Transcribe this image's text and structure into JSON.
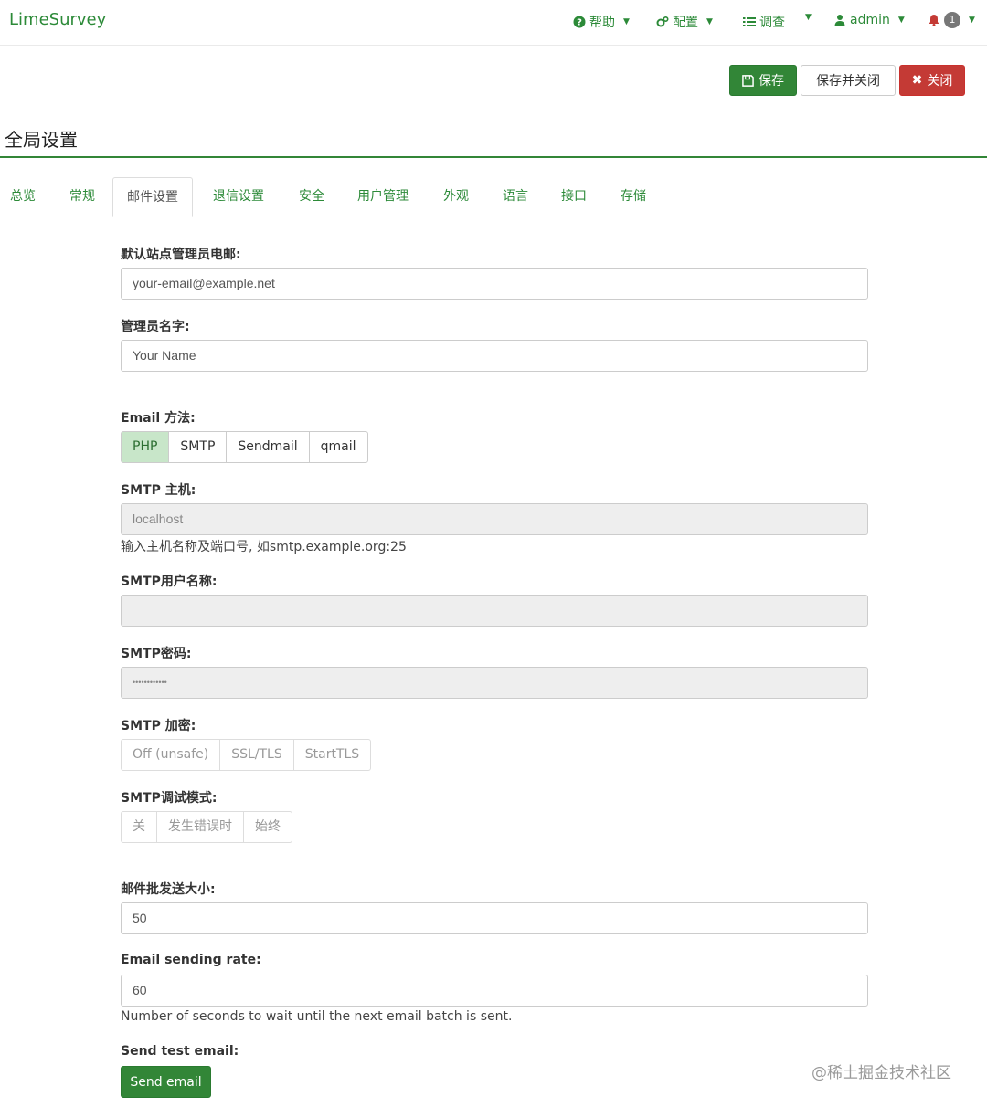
{
  "navbar": {
    "brand": "LimeSurvey",
    "help": "帮助",
    "config": "配置",
    "surveys": "调查",
    "user": "admin",
    "notifications": "1",
    "icons": {
      "help": "question-circle-icon",
      "config": "gears-icon",
      "surveys": "list-icon",
      "user": "user-icon",
      "bell": "bell-icon"
    }
  },
  "actions": {
    "save": "保存",
    "save_close": "保存并关闭",
    "close": "关闭"
  },
  "page": {
    "title": "全局设置"
  },
  "tabs": [
    "总览",
    "常规",
    "邮件设置",
    "退信设置",
    "安全",
    "用户管理",
    "外观",
    "语言",
    "接口",
    "存储"
  ],
  "form": {
    "admin_email": {
      "label": "默认站点管理员电邮:",
      "value": "your-email@example.net"
    },
    "admin_name": {
      "label": "管理员名字:",
      "value": "Your Name"
    },
    "email_method": {
      "label": "Email 方法:",
      "options": [
        "PHP",
        "SMTP",
        "Sendmail",
        "qmail"
      ],
      "selected": "PHP"
    },
    "smtp_host": {
      "label": "SMTP 主机:",
      "value": "localhost",
      "help": "输入主机名称及端口号, 如smtp.example.org:25"
    },
    "smtp_user": {
      "label": "SMTP用户名称:",
      "value": ""
    },
    "smtp_password": {
      "label": "SMTP密码:",
      "value": "••••••••••••"
    },
    "smtp_encryption": {
      "label": "SMTP 加密:",
      "options": [
        "Off (unsafe)",
        "SSL/TLS",
        "StartTLS"
      ]
    },
    "smtp_debug": {
      "label": "SMTP调试模式:",
      "options": [
        "关",
        "发生错误时",
        "始终"
      ]
    },
    "batch_size": {
      "label": "邮件批发送大小:",
      "value": "50"
    },
    "sending_rate": {
      "label": "Email sending rate:",
      "value": "60",
      "help": "Number of seconds to wait until the next email batch is sent."
    },
    "test_email": {
      "label": "Send test email:",
      "button": "Send email"
    }
  },
  "watermark": "@稀土掘金技术社区",
  "colors": {
    "brand_green": "#328637",
    "danger_red": "#c43a35",
    "active_pill": "#c8e6c9"
  }
}
